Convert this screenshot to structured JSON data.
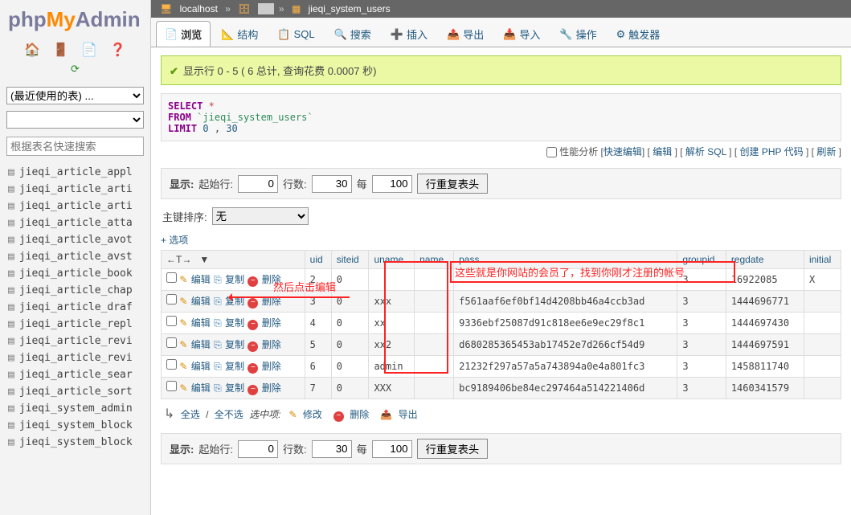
{
  "logo": {
    "p1": "php",
    "p2": "My",
    "p3": "Admin"
  },
  "sidebar": {
    "recent_tables_placeholder": "(最近使用的表) ...",
    "db_select_placeholder": " ",
    "quick_search_placeholder": "根据表名快速搜索",
    "tables": [
      "jieqi_article_appl",
      "jieqi_article_arti",
      "jieqi_article_arti",
      "jieqi_article_atta",
      "jieqi_article_avot",
      "jieqi_article_avst",
      "jieqi_article_book",
      "jieqi_article_chap",
      "jieqi_article_draf",
      "jieqi_article_repl",
      "jieqi_article_revi",
      "jieqi_article_revi",
      "jieqi_article_sear",
      "jieqi_article_sort",
      "jieqi_system_admin",
      "jieqi_system_block",
      "jieqi_system_block"
    ]
  },
  "breadcrumb": {
    "server": "localhost",
    "database": "",
    "table": "jieqi_system_users"
  },
  "tabs": [
    {
      "icon": "📄",
      "label": "浏览",
      "active": true
    },
    {
      "icon": "📐",
      "label": "结构"
    },
    {
      "icon": "📋",
      "label": "SQL"
    },
    {
      "icon": "🔍",
      "label": "搜索"
    },
    {
      "icon": "➕",
      "label": "插入"
    },
    {
      "icon": "📤",
      "label": "导出"
    },
    {
      "icon": "📥",
      "label": "导入"
    },
    {
      "icon": "🔧",
      "label": "操作"
    },
    {
      "icon": "⚙",
      "label": "触发器"
    }
  ],
  "success_msg": "显示行 0 - 5 ( 6 总计, 查询花费 0.0007 秒)",
  "sql": {
    "select": "SELECT",
    "star": "*",
    "from": "FROM",
    "table": "`jieqi_system_users`",
    "limit": "LIMIT",
    "limit_a": "0",
    "limit_b": "30"
  },
  "sql_actions": {
    "perf": "性能分析",
    "quick_edit": "快速编辑",
    "edit": "编辑",
    "explain": "解析 SQL",
    "create_php": "创建 PHP 代码",
    "refresh": "刷新"
  },
  "toolbar": {
    "show": "显示:",
    "start_row": "起始行:",
    "start_val": "0",
    "row_count": "行数:",
    "row_val": "30",
    "every": "每",
    "every_val": "100",
    "repeat_btn": "行重复表头"
  },
  "sort_row": {
    "label": "主键排序:",
    "value": "无"
  },
  "options_link": "+ 选项",
  "row_op_header": "←T→",
  "actions": {
    "edit": "编辑",
    "copy": "复制",
    "delete": "删除"
  },
  "columns": [
    "uid",
    "siteid",
    "uname",
    "name",
    "pass",
    "groupid",
    "regdate",
    "initial"
  ],
  "rows": [
    {
      "uid": "2",
      "siteid": "0",
      "uname": "",
      "name": "",
      "pass": "",
      "groupid": "3",
      "regdate": "16922085",
      "initial": "X"
    },
    {
      "uid": "3",
      "siteid": "0",
      "uname": "xxx",
      "name": "",
      "pass": "f561aaf6ef0bf14d4208bb46a4ccb3ad",
      "groupid": "3",
      "regdate": "1444696771",
      "initial": ""
    },
    {
      "uid": "4",
      "siteid": "0",
      "uname": "xx",
      "name": "",
      "pass": "9336ebf25087d91c818ee6e9ec29f8c1",
      "groupid": "3",
      "regdate": "1444697430",
      "initial": ""
    },
    {
      "uid": "5",
      "siteid": "0",
      "uname": "xx2",
      "name": "",
      "pass": "d680285365453ab17452e7d266cf54d9",
      "groupid": "3",
      "regdate": "1444697591",
      "initial": ""
    },
    {
      "uid": "6",
      "siteid": "0",
      "uname": "admin",
      "name": "",
      "pass": "21232f297a57a5a743894a0e4a801fc3",
      "groupid": "3",
      "regdate": "1458811740",
      "initial": ""
    },
    {
      "uid": "7",
      "siteid": "0",
      "uname": "XXX",
      "name": "",
      "pass": "bc9189406be84ec297464a514221406d",
      "groupid": "3",
      "regdate": "1460341579",
      "initial": ""
    }
  ],
  "bulk": {
    "select_all": "全选",
    "deselect_all": "全不选",
    "with_selected": "选中项:",
    "edit": "修改",
    "delete": "删除",
    "export": "导出"
  },
  "annotations": {
    "click_edit": "然后点击编辑",
    "members_hint": "这些就是你网站的会员了，找到你刚才注册的帐号"
  }
}
